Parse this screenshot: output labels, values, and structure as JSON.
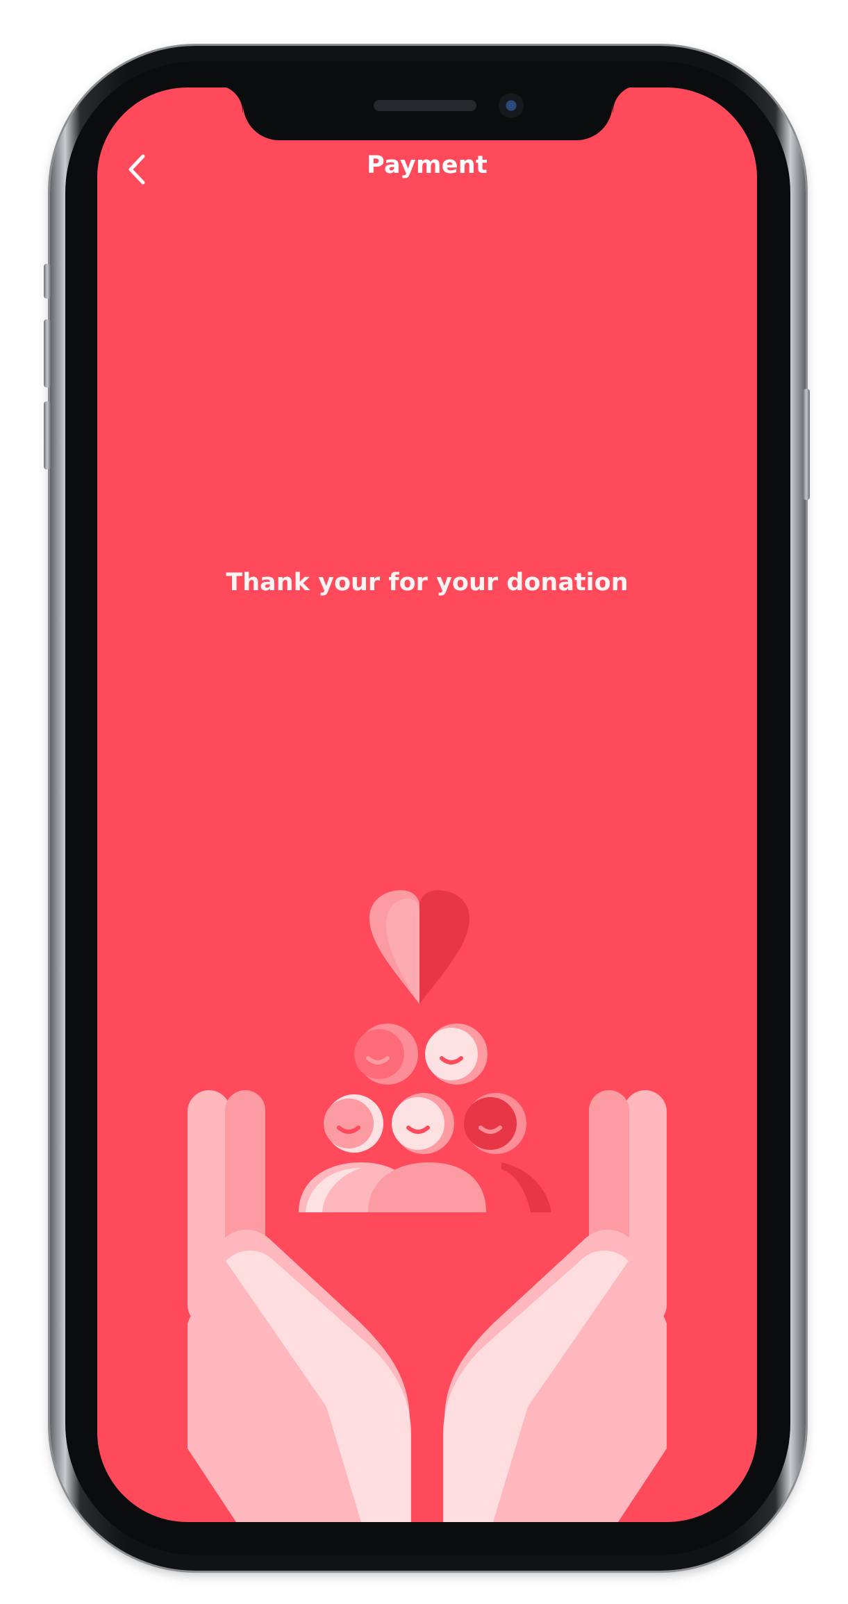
{
  "header": {
    "title": "Payment",
    "back_icon": "chevron-left-icon"
  },
  "main": {
    "message": "Thank your for your donation",
    "illustration_icon": "donation-hands-icon"
  },
  "colors": {
    "screen_background": "#fe4a5a",
    "text": "#ffffff",
    "illustration_light": "#fdb7bd",
    "illustration_mid": "#fd9ba3",
    "illustration_dark": "#e73747"
  }
}
